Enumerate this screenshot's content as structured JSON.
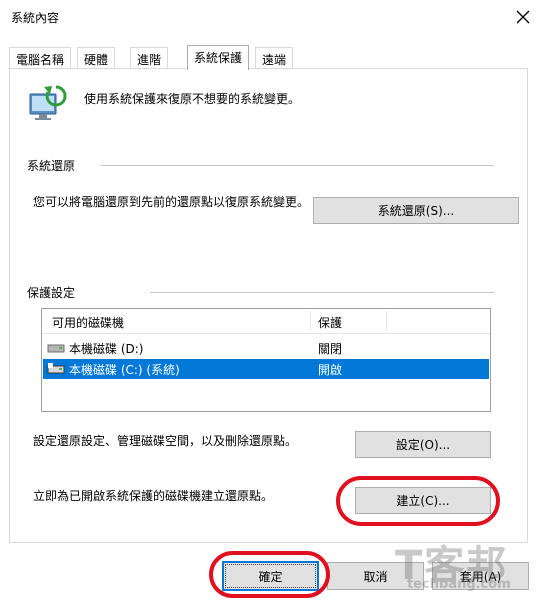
{
  "window": {
    "title": "系統內容"
  },
  "tabs": [
    {
      "label": "電腦名稱"
    },
    {
      "label": "硬體"
    },
    {
      "label": "進階"
    },
    {
      "label": "系統保護",
      "active": true
    },
    {
      "label": "遠端"
    }
  ],
  "intro": {
    "text": "使用系統保護來復原不想要的系統變更。"
  },
  "system_restore": {
    "heading": "系統還原",
    "description": "您可以將電腦還原到先前的還原點以復原系統變更。",
    "button": "系統還原(S)..."
  },
  "protection_settings": {
    "heading": "保護設定",
    "columns": [
      "可用的磁碟機",
      "保護"
    ],
    "drives": [
      {
        "name": "本機磁碟 (D:)",
        "protection": "關閉",
        "selected": false
      },
      {
        "name": "本機磁碟 (C:) (系統)",
        "protection": "開啟",
        "selected": true
      }
    ],
    "configure_text": "設定還原設定、管理磁碟空間，以及刪除還原點。",
    "configure_button": "設定(O)...",
    "create_text": "立即為已開啟系統保護的磁碟機建立還原點。",
    "create_button": "建立(C)..."
  },
  "footer": {
    "ok_button": "確定",
    "cancel_button": "取消",
    "apply_button": "套用(A)"
  },
  "watermark": {
    "big": "T客邦",
    "small": "techbang.com"
  },
  "colors": {
    "accent": "#0078d7",
    "annotation_circle": "#e0101e",
    "button_face": "#e1e1e1"
  }
}
